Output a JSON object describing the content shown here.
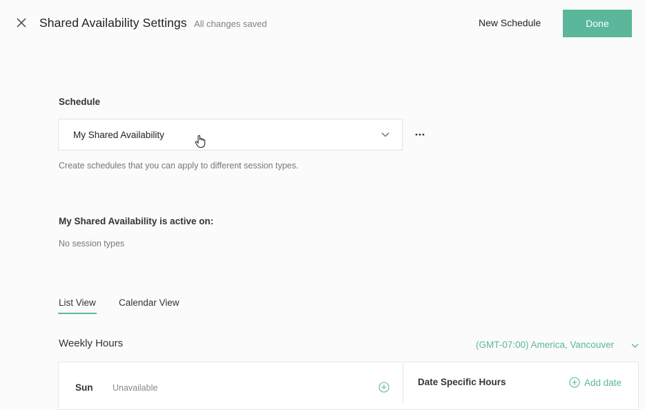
{
  "header": {
    "title": "Shared Availability Settings",
    "save_status": "All changes saved",
    "new_schedule_label": "New Schedule",
    "done_label": "Done"
  },
  "schedule": {
    "label": "Schedule",
    "selected": "My Shared Availability",
    "helper": "Create schedules that you can apply to different session types."
  },
  "active_on": {
    "label": "My Shared Availability is active on:",
    "value": "No session types"
  },
  "tabs": [
    {
      "label": "List View",
      "active": true
    },
    {
      "label": "Calendar View",
      "active": false
    }
  ],
  "weekly_hours": {
    "title": "Weekly Hours",
    "timezone": "(GMT-07:00) America, Vancouver",
    "days": [
      {
        "day": "Sun",
        "status": "Unavailable"
      }
    ]
  },
  "date_specific": {
    "title": "Date Specific Hours",
    "add_label": "Add date"
  },
  "colors": {
    "accent": "#5bb79a",
    "background": "#fbfbfb"
  }
}
